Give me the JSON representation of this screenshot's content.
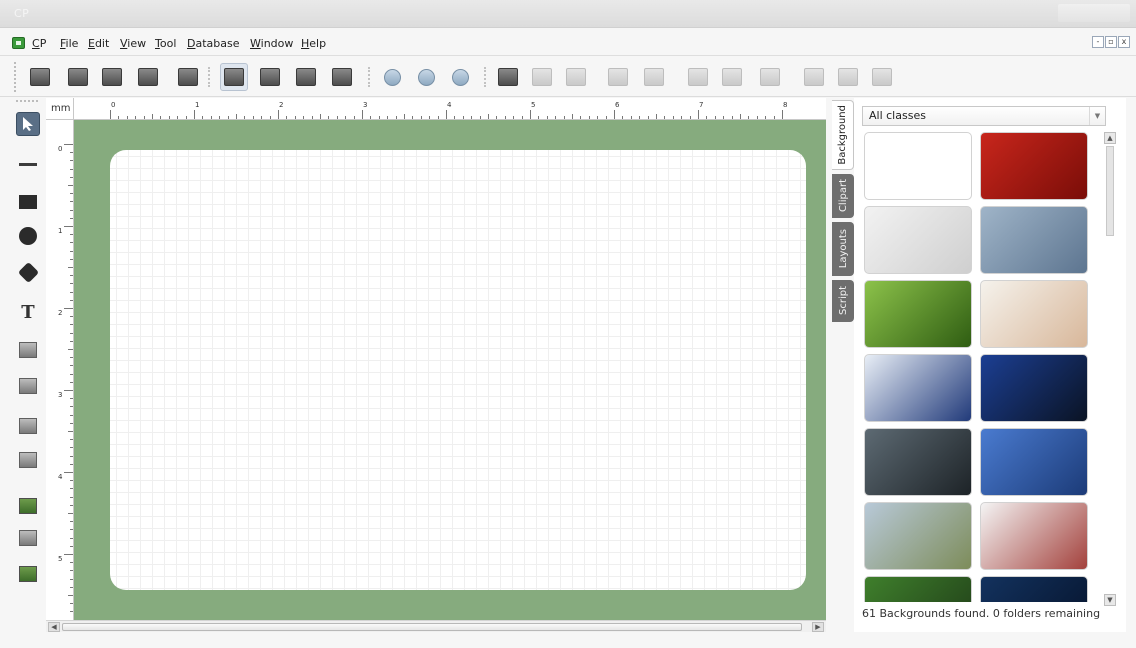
{
  "window": {
    "title": "CP"
  },
  "menu": {
    "app": "CP",
    "items": [
      "File",
      "Edit",
      "View",
      "Tool",
      "Database",
      "Window",
      "Help"
    ],
    "mdi_buttons": [
      "-",
      "▫",
      "x"
    ]
  },
  "toolbar": {
    "buttons": [
      {
        "name": "new-card-icon"
      },
      {
        "name": "open-icon"
      },
      {
        "name": "save-icon"
      },
      {
        "name": "save-as-icon"
      },
      {
        "name": "print-icon"
      },
      {
        "name": "card-front-icon"
      },
      {
        "name": "card-back-icon"
      },
      {
        "name": "database-icon"
      },
      {
        "name": "preview-icon"
      },
      {
        "name": "zoom-in-icon"
      },
      {
        "name": "zoom-out-icon"
      },
      {
        "name": "zoom-fit-icon"
      },
      {
        "name": "align-left-icon"
      },
      {
        "name": "align-center-icon"
      },
      {
        "name": "align-right-icon"
      },
      {
        "name": "align-top-icon"
      },
      {
        "name": "align-middle-icon"
      },
      {
        "name": "align-bottom-icon"
      },
      {
        "name": "distribute-h-icon"
      },
      {
        "name": "distribute-v-icon"
      },
      {
        "name": "bring-front-icon"
      },
      {
        "name": "send-back-icon"
      },
      {
        "name": "lock-icon"
      }
    ]
  },
  "tools": [
    {
      "name": "select-tool"
    },
    {
      "name": "line-tool"
    },
    {
      "name": "rectangle-tool"
    },
    {
      "name": "ellipse-tool"
    },
    {
      "name": "star-tool"
    },
    {
      "name": "text-tool",
      "glyph": "T"
    },
    {
      "name": "counter-tool"
    },
    {
      "name": "date-tool"
    },
    {
      "name": "barcode-tool"
    },
    {
      "name": "qrcode-tool"
    },
    {
      "name": "image-tool"
    },
    {
      "name": "camera-tool"
    },
    {
      "name": "background-tool"
    }
  ],
  "ruler": {
    "unit": "mm",
    "top_labels": [
      "0",
      "1",
      "2",
      "3",
      "4",
      "5",
      "6",
      "7",
      "8"
    ],
    "left_labels": [
      "0",
      "1",
      "2",
      "3",
      "4",
      "5"
    ]
  },
  "side_tabs": [
    "Background",
    "Clipart",
    "Layouts",
    "Script"
  ],
  "panel": {
    "filter": "All classes",
    "status": "61 Backgrounds found. 0 folders remaining",
    "thumbnails": [
      {
        "name": "blank",
        "colors": [
          "#ffffff",
          "#ffffff"
        ]
      },
      {
        "name": "christmas-ornaments",
        "colors": [
          "#c8261c",
          "#7a0d08"
        ]
      },
      {
        "name": "love-target",
        "colors": [
          "#f2f2f2",
          "#cfcfcf"
        ]
      },
      {
        "name": "blueprint-pen",
        "colors": [
          "#9fb4c8",
          "#5d7590"
        ]
      },
      {
        "name": "green-grass",
        "colors": [
          "#8cc24a",
          "#2f5d12"
        ]
      },
      {
        "name": "hand-globe",
        "colors": [
          "#f5f2ec",
          "#d8b79a"
        ]
      },
      {
        "name": "calendar",
        "colors": [
          "#e8eef6",
          "#213a7a"
        ]
      },
      {
        "name": "blue-car",
        "colors": [
          "#1c3f93",
          "#0a1324"
        ]
      },
      {
        "name": "spiral-stairs",
        "colors": [
          "#5d6a73",
          "#1d2327"
        ]
      },
      {
        "name": "sailboat-sea",
        "colors": [
          "#4a7bd0",
          "#1c3b78"
        ]
      },
      {
        "name": "truck-road",
        "colors": [
          "#b8c9d8",
          "#7d8c5a"
        ]
      },
      {
        "name": "hands-phone",
        "colors": [
          "#f4f4f4",
          "#a3413c"
        ]
      },
      {
        "name": "forest",
        "colors": [
          "#3f7f2c",
          "#1e3b17"
        ]
      },
      {
        "name": "dark-blue",
        "colors": [
          "#13325e",
          "#05122a"
        ]
      }
    ]
  },
  "colors": {
    "workarea": "#86ab7e",
    "card": "#ffffff",
    "active_tool": "#5a6f86"
  }
}
